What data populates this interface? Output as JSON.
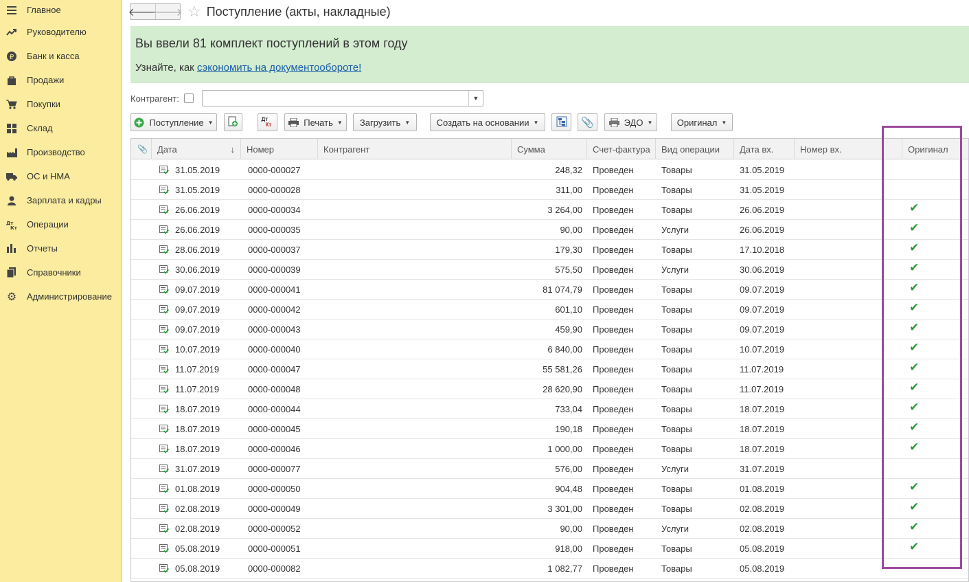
{
  "sidebar": {
    "items": [
      {
        "label": "Главное",
        "icon": "menu-icon"
      },
      {
        "label": "Руководителю",
        "icon": "trend-icon"
      },
      {
        "label": "Банк и касса",
        "icon": "ruble-icon"
      },
      {
        "label": "Продажи",
        "icon": "bag-icon"
      },
      {
        "label": "Покупки",
        "icon": "cart-icon"
      },
      {
        "label": "Склад",
        "icon": "grid-icon"
      },
      {
        "label": "Производство",
        "icon": "factory-icon"
      },
      {
        "label": "ОС и НМА",
        "icon": "truck-icon"
      },
      {
        "label": "Зарплата и кадры",
        "icon": "person-icon"
      },
      {
        "label": "Операции",
        "icon": "dt-kt-icon"
      },
      {
        "label": "Отчеты",
        "icon": "bar-chart-icon"
      },
      {
        "label": "Справочники",
        "icon": "books-icon"
      },
      {
        "label": "Администрирование",
        "icon": "gear-icon"
      }
    ]
  },
  "header": {
    "back": "🡐",
    "forward": "🡒",
    "title": "Поступление (акты, накладные)"
  },
  "banner": {
    "headline": "Вы ввели 81 комплект поступлений в этом году",
    "prefix": "Узнайте, как ",
    "link": "сэкономить на документообороте!"
  },
  "filter": {
    "label": "Контрагент:",
    "value": ""
  },
  "toolbar": {
    "postuplenie": "Поступление",
    "pechat": "Печать",
    "zagruzit": "Загрузить",
    "sozdat": "Создать на основании",
    "edo": "ЭДО",
    "original": "Оригинал",
    "dtkt_top": "Дт",
    "dtkt_bottom": "Кт"
  },
  "columns": {
    "date": "Дата",
    "number": "Номер",
    "counterparty": "Контрагент",
    "sum": "Сумма",
    "invoice": "Счет-фактура",
    "operation": "Вид операции",
    "in_date": "Дата вх.",
    "in_number": "Номер вх.",
    "original": "Оригинал",
    "sort_arrow": "↓"
  },
  "rows": [
    {
      "date": "31.05.2019",
      "number": "0000-000027",
      "sum": "248,32",
      "invoice": "Проведен",
      "op": "Товары",
      "in_date": "31.05.2019",
      "orig": ""
    },
    {
      "date": "31.05.2019",
      "number": "0000-000028",
      "sum": "311,00",
      "invoice": "Проведен",
      "op": "Товары",
      "in_date": "31.05.2019",
      "orig": ""
    },
    {
      "date": "26.06.2019",
      "number": "0000-000034",
      "sum": "3 264,00",
      "invoice": "Проведен",
      "op": "Товары",
      "in_date": "26.06.2019",
      "orig": "✔"
    },
    {
      "date": "26.06.2019",
      "number": "0000-000035",
      "sum": "90,00",
      "invoice": "Проведен",
      "op": "Услуги",
      "in_date": "26.06.2019",
      "orig": "✔"
    },
    {
      "date": "28.06.2019",
      "number": "0000-000037",
      "sum": "179,30",
      "invoice": "Проведен",
      "op": "Товары",
      "in_date": "17.10.2018",
      "orig": "✔"
    },
    {
      "date": "30.06.2019",
      "number": "0000-000039",
      "sum": "575,50",
      "invoice": "Проведен",
      "op": "Услуги",
      "in_date": "30.06.2019",
      "orig": "✔"
    },
    {
      "date": "09.07.2019",
      "number": "0000-000041",
      "sum": "81 074,79",
      "invoice": "Проведен",
      "op": "Товары",
      "in_date": "09.07.2019",
      "orig": "✔"
    },
    {
      "date": "09.07.2019",
      "number": "0000-000042",
      "sum": "601,10",
      "invoice": "Проведен",
      "op": "Товары",
      "in_date": "09.07.2019",
      "orig": "✔"
    },
    {
      "date": "09.07.2019",
      "number": "0000-000043",
      "sum": "459,90",
      "invoice": "Проведен",
      "op": "Товары",
      "in_date": "09.07.2019",
      "orig": "✔"
    },
    {
      "date": "10.07.2019",
      "number": "0000-000040",
      "sum": "6 840,00",
      "invoice": "Проведен",
      "op": "Товары",
      "in_date": "10.07.2019",
      "orig": "✔"
    },
    {
      "date": "11.07.2019",
      "number": "0000-000047",
      "sum": "55 581,26",
      "invoice": "Проведен",
      "op": "Товары",
      "in_date": "11.07.2019",
      "orig": "✔"
    },
    {
      "date": "11.07.2019",
      "number": "0000-000048",
      "sum": "28 620,90",
      "invoice": "Проведен",
      "op": "Товары",
      "in_date": "11.07.2019",
      "orig": "✔"
    },
    {
      "date": "18.07.2019",
      "number": "0000-000044",
      "sum": "733,04",
      "invoice": "Проведен",
      "op": "Товары",
      "in_date": "18.07.2019",
      "orig": "✔"
    },
    {
      "date": "18.07.2019",
      "number": "0000-000045",
      "sum": "190,18",
      "invoice": "Проведен",
      "op": "Товары",
      "in_date": "18.07.2019",
      "orig": "✔"
    },
    {
      "date": "18.07.2019",
      "number": "0000-000046",
      "sum": "1 000,00",
      "invoice": "Проведен",
      "op": "Товары",
      "in_date": "18.07.2019",
      "orig": "✔"
    },
    {
      "date": "31.07.2019",
      "number": "0000-000077",
      "sum": "576,00",
      "invoice": "Проведен",
      "op": "Услуги",
      "in_date": "31.07.2019",
      "orig": ""
    },
    {
      "date": "01.08.2019",
      "number": "0000-000050",
      "sum": "904,48",
      "invoice": "Проведен",
      "op": "Товары",
      "in_date": "01.08.2019",
      "orig": "✔"
    },
    {
      "date": "02.08.2019",
      "number": "0000-000049",
      "sum": "3 301,00",
      "invoice": "Проведен",
      "op": "Товары",
      "in_date": "02.08.2019",
      "orig": "✔"
    },
    {
      "date": "02.08.2019",
      "number": "0000-000052",
      "sum": "90,00",
      "invoice": "Проведен",
      "op": "Услуги",
      "in_date": "02.08.2019",
      "orig": "✔"
    },
    {
      "date": "05.08.2019",
      "number": "0000-000051",
      "sum": "918,00",
      "invoice": "Проведен",
      "op": "Товары",
      "in_date": "05.08.2019",
      "orig": "✔"
    },
    {
      "date": "05.08.2019",
      "number": "0000-000082",
      "sum": "1 082,77",
      "invoice": "Проведен",
      "op": "Товары",
      "in_date": "05.08.2019",
      "orig": ""
    }
  ],
  "colors": {
    "sidebar_bg": "#fbeca0",
    "banner_bg": "#d4ecd0",
    "link": "#1a5fa8",
    "check": "#2a9a3a",
    "highlight": "#9b4a9e"
  }
}
